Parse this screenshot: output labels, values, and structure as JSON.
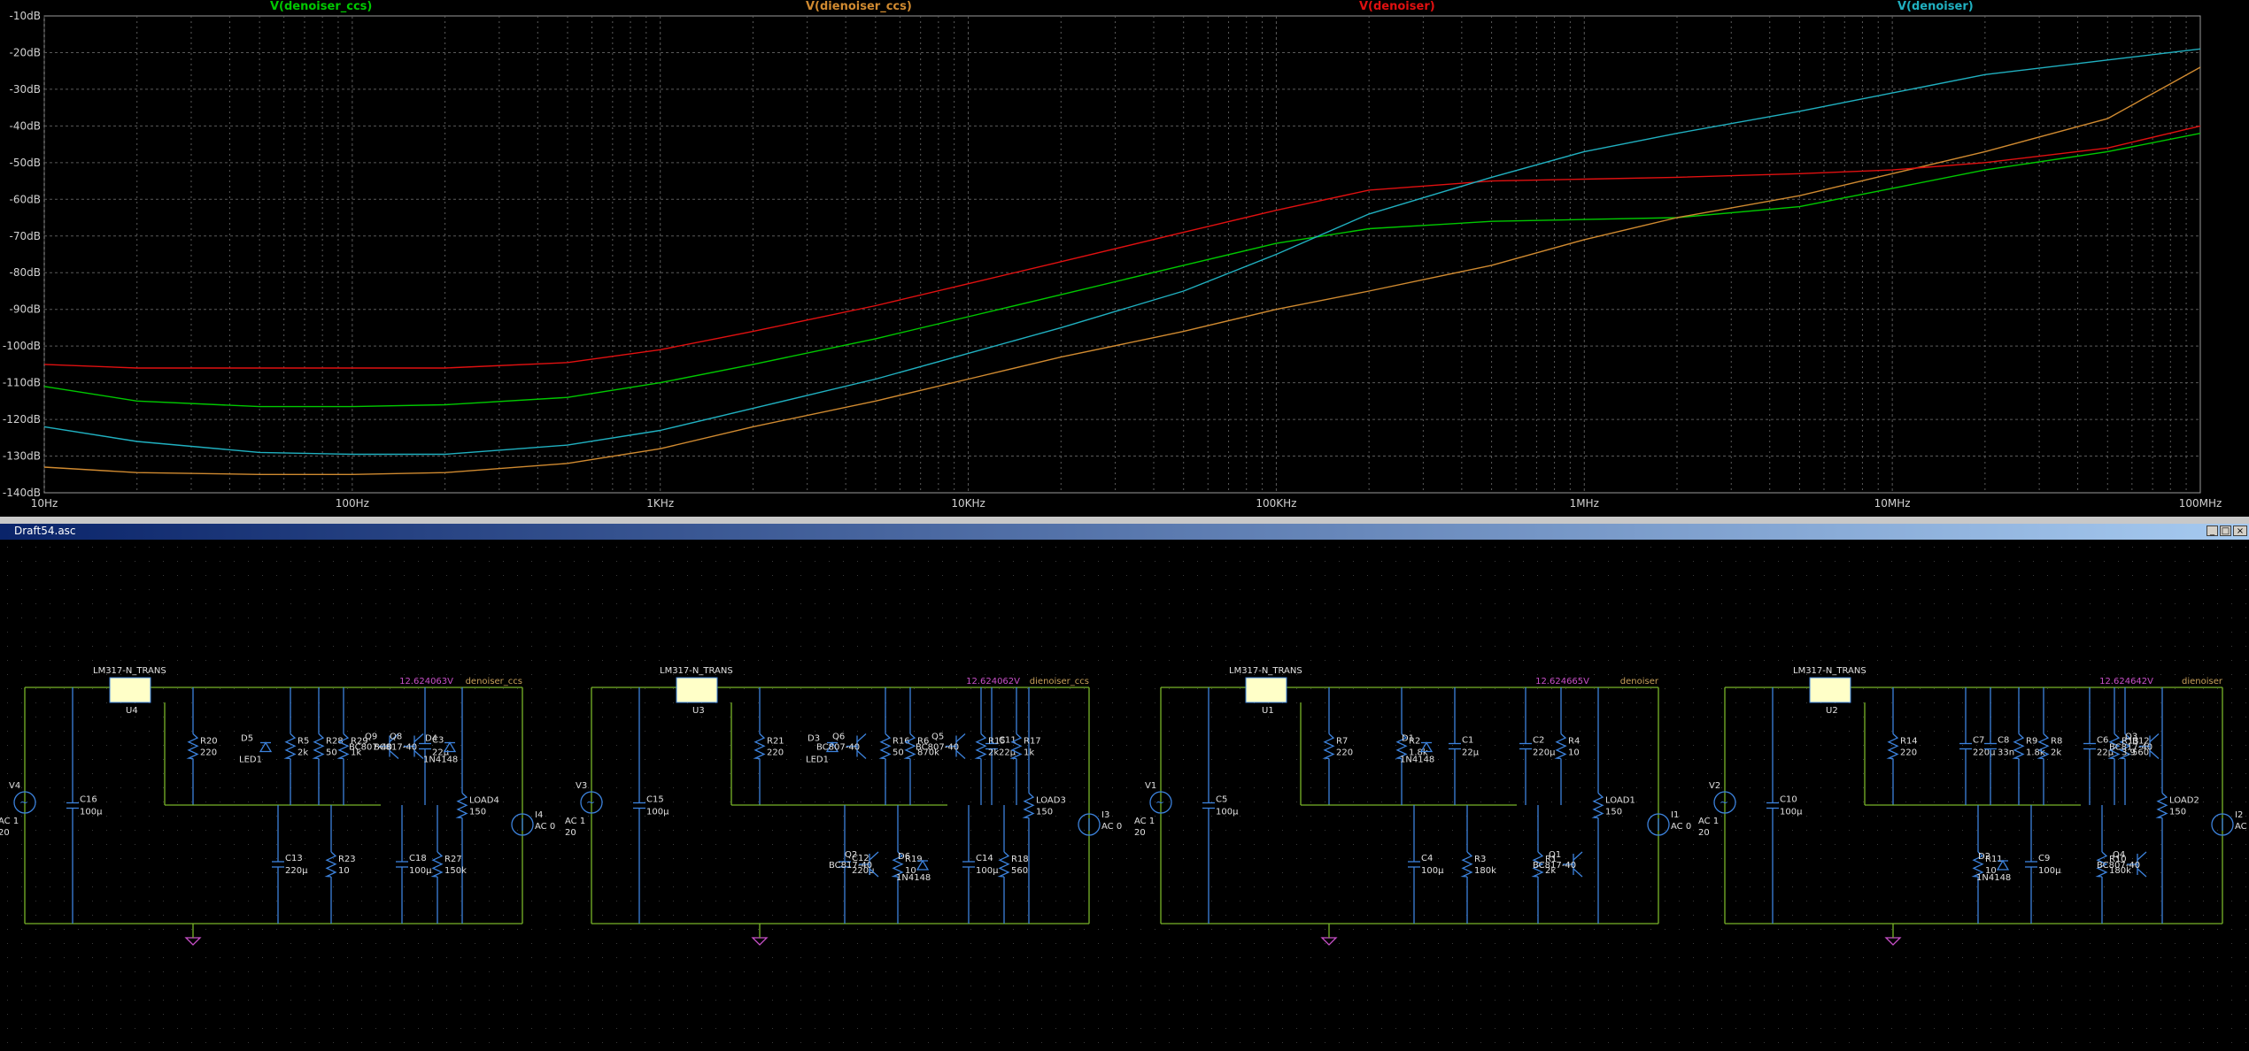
{
  "plot": {
    "traces": [
      {
        "name": "V(denoiser_ccs)",
        "color": "#00c800",
        "points": [
          [
            10,
            -111
          ],
          [
            20,
            -115
          ],
          [
            50,
            -116.5
          ],
          [
            100,
            -116.5
          ],
          [
            200,
            -116
          ],
          [
            500,
            -114
          ],
          [
            1000,
            -110
          ],
          [
            2000,
            -105
          ],
          [
            5000,
            -98
          ],
          [
            10000,
            -92
          ],
          [
            20000,
            -86
          ],
          [
            50000,
            -78
          ],
          [
            100000,
            -72
          ],
          [
            200000,
            -68
          ],
          [
            500000,
            -66
          ],
          [
            1000000,
            -65.5
          ],
          [
            2000000,
            -65
          ],
          [
            5000000,
            -62
          ],
          [
            10000000,
            -57
          ],
          [
            20000000,
            -52
          ],
          [
            50000000,
            -47
          ],
          [
            100000000,
            -42
          ]
        ]
      },
      {
        "name": "V(dienoiser_ccs)",
        "color": "#d08a30",
        "points": [
          [
            10,
            -133
          ],
          [
            20,
            -134.5
          ],
          [
            50,
            -135
          ],
          [
            100,
            -135
          ],
          [
            200,
            -134.5
          ],
          [
            500,
            -132
          ],
          [
            1000,
            -128
          ],
          [
            2000,
            -122
          ],
          [
            5000,
            -115
          ],
          [
            10000,
            -109
          ],
          [
            20000,
            -103
          ],
          [
            50000,
            -96
          ],
          [
            100000,
            -90
          ],
          [
            200000,
            -85
          ],
          [
            500000,
            -78
          ],
          [
            1000000,
            -71
          ],
          [
            2000000,
            -65
          ],
          [
            5000000,
            -59
          ],
          [
            10000000,
            -53
          ],
          [
            20000000,
            -47
          ],
          [
            50000000,
            -38
          ],
          [
            100000000,
            -24
          ]
        ]
      },
      {
        "name": "V(denoiser)",
        "color": "#e01010",
        "points": [
          [
            10,
            -105
          ],
          [
            20,
            -106
          ],
          [
            50,
            -106
          ],
          [
            100,
            -106
          ],
          [
            200,
            -106
          ],
          [
            500,
            -104.5
          ],
          [
            1000,
            -101
          ],
          [
            2000,
            -96
          ],
          [
            5000,
            -89
          ],
          [
            10000,
            -83
          ],
          [
            20000,
            -77
          ],
          [
            50000,
            -69
          ],
          [
            100000,
            -63
          ],
          [
            200000,
            -57.5
          ],
          [
            500000,
            -55
          ],
          [
            1000000,
            -54.5
          ],
          [
            2000000,
            -54
          ],
          [
            5000000,
            -53
          ],
          [
            10000000,
            -52
          ],
          [
            20000000,
            -50
          ],
          [
            50000000,
            -46
          ],
          [
            100000000,
            -40
          ]
        ]
      },
      {
        "name": "V(denoiser)",
        "color": "#20b0c0",
        "points": [
          [
            10,
            -122
          ],
          [
            20,
            -126
          ],
          [
            50,
            -129
          ],
          [
            100,
            -129.5
          ],
          [
            200,
            -129.5
          ],
          [
            500,
            -127
          ],
          [
            1000,
            -123
          ],
          [
            2000,
            -117
          ],
          [
            5000,
            -109
          ],
          [
            10000,
            -102
          ],
          [
            20000,
            -95
          ],
          [
            50000,
            -85
          ],
          [
            100000,
            -75
          ],
          [
            200000,
            -64
          ],
          [
            500000,
            -54
          ],
          [
            1000000,
            -47
          ],
          [
            2000000,
            -42
          ],
          [
            5000000,
            -36
          ],
          [
            10000000,
            -31
          ],
          [
            20000000,
            -26
          ],
          [
            50000000,
            -22
          ],
          [
            100000000,
            -19
          ]
        ]
      }
    ],
    "y_ticks": [
      "-10dB",
      "-20dB",
      "-30dB",
      "-40dB",
      "-50dB",
      "-60dB",
      "-70dB",
      "-80dB",
      "-90dB",
      "-100dB",
      "-110dB",
      "-120dB",
      "-130dB",
      "-140dB"
    ],
    "x_ticks": [
      "10Hz",
      "100Hz",
      "1KHz",
      "10KHz",
      "100KHz",
      "1MHz",
      "10MHz",
      "100MHz"
    ]
  },
  "window": {
    "title": "Draft54.asc",
    "minimize": "_",
    "restore": "□",
    "close": "×"
  },
  "circuits": [
    {
      "regulator": "LM317-N_TRANS",
      "ref": "U4",
      "net": "denoiser_ccs",
      "voltage": "12.624063V",
      "src": [
        "V4",
        "AC 1",
        "20"
      ],
      "load": [
        "LOAD4",
        "150"
      ],
      "isrc": [
        "I4",
        "AC 0"
      ],
      "parts": [
        [
          "C16",
          "100µ"
        ],
        [
          "R20",
          "220"
        ],
        [
          "D5",
          "LED1"
        ],
        [
          "R28",
          "50"
        ],
        [
          "Q9",
          "BC807-40"
        ],
        [
          "C3",
          "22µ"
        ],
        [
          "C13",
          "220µ"
        ],
        [
          "R23",
          "10"
        ],
        [
          "C18",
          "100µ"
        ],
        [
          "R27",
          "150k"
        ],
        [
          "R5",
          "2k"
        ],
        [
          "R29",
          "1k"
        ],
        [
          "Q8",
          "BC817-40"
        ],
        [
          "D4",
          "1N4148"
        ]
      ]
    },
    {
      "regulator": "LM317-N_TRANS",
      "ref": "U3",
      "net": "dienoiser_ccs",
      "voltage": "12.624062V",
      "src": [
        "V3",
        "AC 1",
        "20"
      ],
      "load": [
        "LOAD3",
        "150"
      ],
      "isrc": [
        "I3",
        "AC 0"
      ],
      "parts": [
        [
          "C15",
          "100µ"
        ],
        [
          "R21",
          "220"
        ],
        [
          "D3",
          "LED1"
        ],
        [
          "R16",
          "50"
        ],
        [
          "Q5",
          "BC807-40"
        ],
        [
          "C11",
          "22µ"
        ],
        [
          "C12",
          "220µ"
        ],
        [
          "R19",
          "10"
        ],
        [
          "C14",
          "100µ"
        ],
        [
          "R18",
          "560"
        ],
        [
          "Q6",
          "BC807-40"
        ],
        [
          "R6",
          "870k"
        ],
        [
          "R15",
          "2k"
        ],
        [
          "R17",
          "1k"
        ],
        [
          "Q2",
          "BC817-40"
        ],
        [
          "D6",
          "1N4148"
        ]
      ]
    },
    {
      "regulator": "LM317-N_TRANS",
      "ref": "U1",
      "net": "denoiser",
      "voltage": "12.624665V",
      "src": [
        "V1",
        "AC 1",
        "20"
      ],
      "load": [
        "LOAD1",
        "150"
      ],
      "isrc": [
        "I1",
        "AC 0"
      ],
      "parts": [
        [
          "C5",
          "100µ"
        ],
        [
          "R7",
          "220"
        ],
        [
          "R2",
          "1.8k"
        ],
        [
          "C1",
          "22µ"
        ],
        [
          "C2",
          "220µ"
        ],
        [
          "R4",
          "10"
        ],
        [
          "C4",
          "100µ"
        ],
        [
          "R3",
          "180k"
        ],
        [
          "R1",
          "2k"
        ],
        [
          "Q1",
          "BC817-40"
        ],
        [
          "D1",
          "1N4148"
        ]
      ]
    },
    {
      "regulator": "LM317-N_TRANS",
      "ref": "U2",
      "net": "dienoiser",
      "voltage": "12.624642V",
      "src": [
        "V2",
        "AC 1",
        "20"
      ],
      "load": [
        "LOAD2",
        "150"
      ],
      "isrc": [
        "I2",
        "AC 0"
      ],
      "parts": [
        [
          "C10",
          "100µ"
        ],
        [
          "R14",
          "220"
        ],
        [
          "C7",
          "220µ"
        ],
        [
          "R9",
          "1.8k"
        ],
        [
          "C6",
          "22µ"
        ],
        [
          "R12",
          "560"
        ],
        [
          "R11",
          "10"
        ],
        [
          "C9",
          "100µ"
        ],
        [
          "R10",
          "180k"
        ],
        [
          "Q4",
          "BC807-40"
        ],
        [
          "C8",
          "33n"
        ],
        [
          "R8",
          "2k"
        ],
        [
          "R13",
          "3.9"
        ],
        [
          "Q3",
          "BC817-40"
        ],
        [
          "D2",
          "1N4148"
        ]
      ]
    }
  ]
}
